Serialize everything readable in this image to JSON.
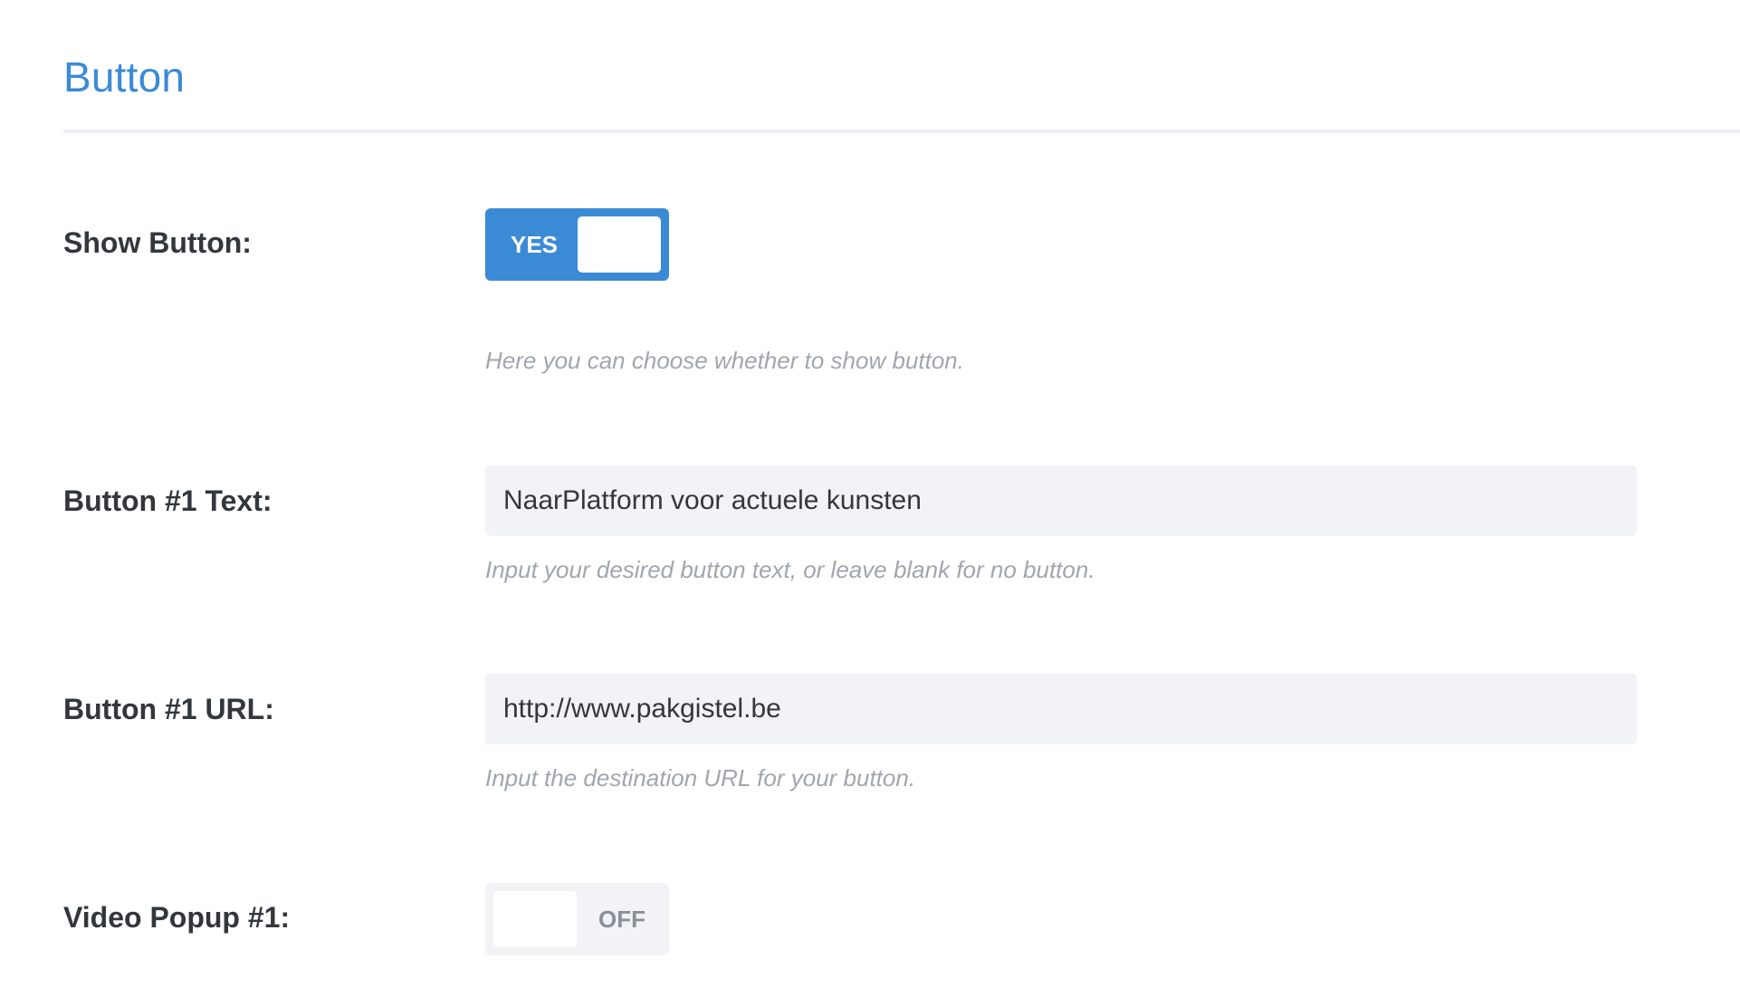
{
  "section": {
    "title": "Button"
  },
  "show_button": {
    "label": "Show Button:",
    "toggle_text": "YES",
    "toggle_state": "on",
    "description": "Here you can choose whether to show button."
  },
  "button1_text": {
    "label": "Button #1 Text:",
    "value": "NaarPlatform voor actuele kunsten",
    "description": "Input your desired button text, or leave blank for no button."
  },
  "button1_url": {
    "label": "Button #1 URL:",
    "value": "http://www.pakgistel.be",
    "description": "Input the destination URL for your button."
  },
  "video_popup1": {
    "label": "Video Popup #1:",
    "toggle_text": "OFF",
    "toggle_state": "off"
  },
  "colors": {
    "accent": "#3b8ad6",
    "label_text": "#32373c",
    "description_text": "#a0a6ae",
    "input_background": "#f1f3f6"
  }
}
